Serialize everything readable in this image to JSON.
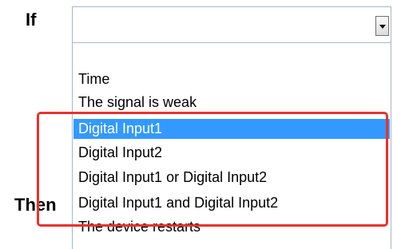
{
  "labels": {
    "if": "If",
    "then": "Then"
  },
  "dropdown": {
    "selected_value": "",
    "options": [
      "Time",
      "The signal is weak",
      "Digital Input1",
      "Digital Input2",
      "Digital Input1 or Digital Input2",
      "Digital Input1 and Digital Input2",
      "The device restarts"
    ],
    "highlighted_option": "Digital Input1"
  },
  "colors": {
    "selection": "#3399ff",
    "annotation_box": "#e8322f"
  },
  "icons": {
    "dropdown_button": "chevron-down-icon"
  }
}
